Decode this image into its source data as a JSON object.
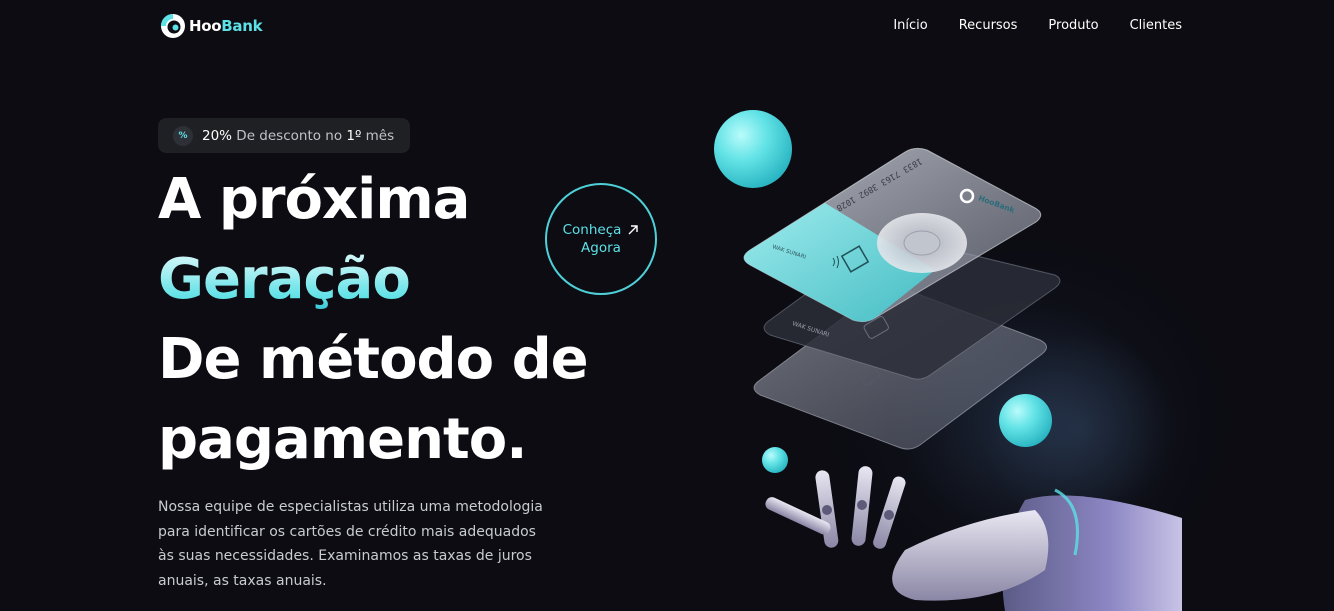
{
  "nav": {
    "logo": {
      "prefix": "Hoo",
      "suffix": "Bank"
    },
    "links": [
      "Início",
      "Recursos",
      "Produto",
      "Clientes"
    ]
  },
  "badge": {
    "icon": "percent-icon",
    "highlight1": "20%",
    "middle": " De desconto no ",
    "highlight2": "1º",
    "end": " mês"
  },
  "hero": {
    "line1": "A próxima",
    "line2": "Geração",
    "line3": "De método de",
    "line4": "pagamento.",
    "description": "Nossa equipe de especialistas utiliza uma metodologia para identificar os cartões de crédito mais adequados às suas necessidades. Examinamos as taxas de juros anuais, as taxas anuais."
  },
  "cta": {
    "line1": "Conheça",
    "line2": "Agora",
    "icon": "arrow-up-right-icon"
  },
  "illustration": {
    "card_number": "1833 7163 3892 1028",
    "card_brand": "HooBank",
    "card_holder": "WAK SUNARI",
    "card_expiry": "09/2024"
  },
  "colors": {
    "accent": "#5ce1e6",
    "background": "#0c0c12",
    "badge_bg": "#1f2023"
  }
}
